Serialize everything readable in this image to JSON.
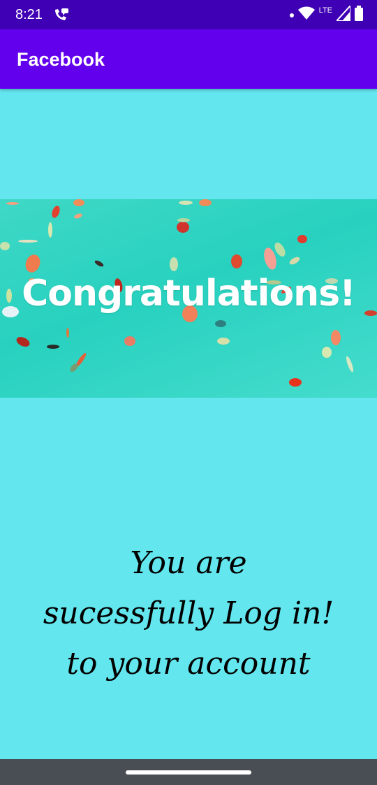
{
  "status_bar": {
    "time": "8:21",
    "network_label": "LTE",
    "icons": [
      "call-icon",
      "notification-dot-icon",
      "wifi-icon",
      "signal-icon",
      "battery-icon"
    ]
  },
  "app_bar": {
    "title": "Facebook"
  },
  "banner": {
    "text": "Congratulations!",
    "background_color": "#2ED3C2"
  },
  "message": {
    "lines": [
      "You are",
      "sucessfully Log in!",
      "to your account"
    ]
  },
  "colors": {
    "status_bar": "#3F00B5",
    "app_bar": "#6200EE",
    "page_background": "#63E6EE",
    "nav_bar": "#494E54"
  }
}
